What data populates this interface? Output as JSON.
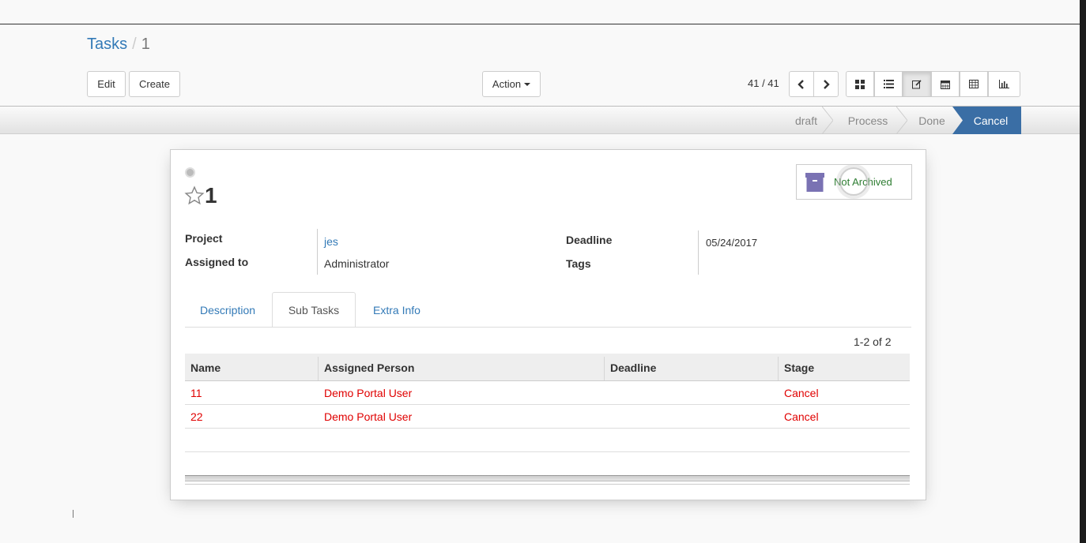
{
  "breadcrumb": {
    "parent": "Tasks",
    "separator": "/",
    "current": "1"
  },
  "toolbar": {
    "edit_label": "Edit",
    "create_label": "Create",
    "action_label": "Action"
  },
  "pager": {
    "value": "41 / 41"
  },
  "views": [
    "kanban-view-icon",
    "list-view-icon",
    "form-view-icon",
    "calendar-view-icon",
    "pivot-view-icon",
    "graph-view-icon"
  ],
  "statusbar": {
    "stages": [
      "draft",
      "Process",
      "Done",
      "Cancel"
    ],
    "active": "Cancel",
    "active_color": "#3a6ea5"
  },
  "record": {
    "title": "1",
    "archive_label": "Not Archived",
    "fields": {
      "project_label": "Project",
      "project_value": "jes",
      "assigned_label": "Assigned to",
      "assigned_value": "Administrator",
      "deadline_label": "Deadline",
      "deadline_value": "05/24/2017",
      "tags_label": "Tags"
    }
  },
  "tabs": [
    "Description",
    "Sub Tasks",
    "Extra Info"
  ],
  "active_tab": "Sub Tasks",
  "subtasks": {
    "pager": "1-2 of 2",
    "columns": [
      "Name",
      "Assigned Person",
      "Deadline",
      "Stage"
    ],
    "rows": [
      [
        "11",
        "Demo Portal User",
        "",
        "Cancel"
      ],
      [
        "22",
        "Demo Portal User",
        "",
        "Cancel"
      ]
    ],
    "row_color": "#e00000"
  }
}
